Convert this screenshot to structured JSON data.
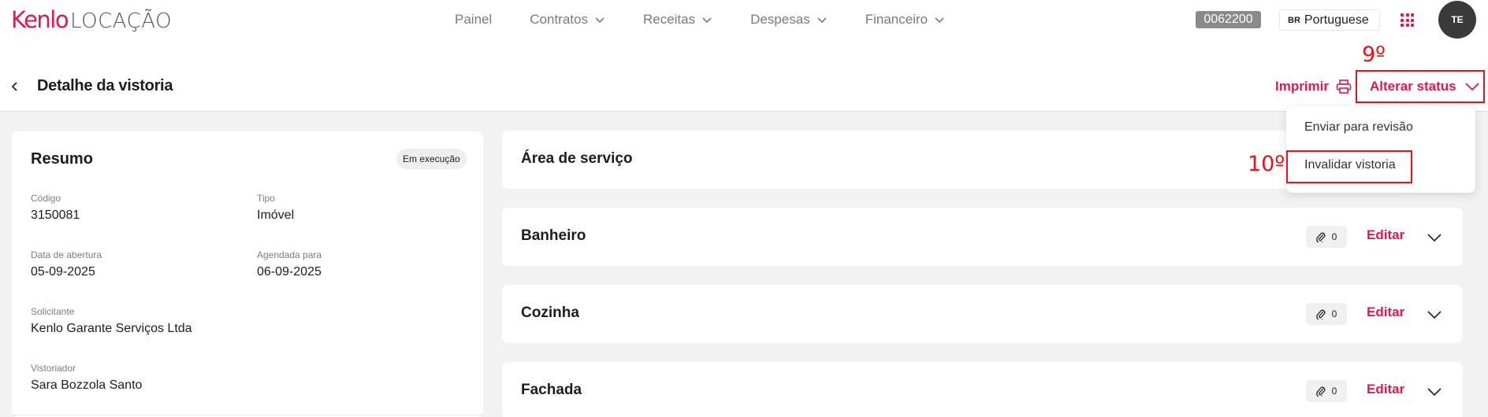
{
  "brand": {
    "name_a": "Kenlo",
    "name_b": "LOCAÇÃO",
    "accent": "#e0194f",
    "annotation_color": "#e4141b"
  },
  "nav": {
    "items": [
      {
        "label": "Painel",
        "has_dropdown": false
      },
      {
        "label": "Contratos",
        "has_dropdown": true
      },
      {
        "label": "Receitas",
        "has_dropdown": true
      },
      {
        "label": "Despesas",
        "has_dropdown": true
      },
      {
        "label": "Financeiro",
        "has_dropdown": true
      }
    ],
    "account_code": "0062200",
    "language": {
      "flag": "BR",
      "label": "Portuguese"
    },
    "apps_icon": "grid-icon",
    "avatar_initials": "TE"
  },
  "header": {
    "title": "Detalhe da vistoria",
    "print_label": "Imprimir",
    "status_label": "Alterar status"
  },
  "annotations": {
    "step_9": "9º",
    "step_10": "10º"
  },
  "status_menu": {
    "items": [
      "Enviar para revisão",
      "Invalidar vistoria"
    ]
  },
  "summary": {
    "title": "Resumo",
    "badge": "Em execução",
    "fields": [
      {
        "label": "Código",
        "value": "3150081"
      },
      {
        "label": "Tipo",
        "value": "Imóvel"
      },
      {
        "label": "Data de abertura",
        "value": "05-09-2025"
      },
      {
        "label": "Agendada para",
        "value": "06-09-2025"
      },
      {
        "label": "Solicitante",
        "value": "Kenlo Garante Serviços Ltda"
      },
      {
        "label": "Vistoriador",
        "value": "Sara Bozzola Santo"
      }
    ]
  },
  "sections": {
    "edit_label": "Editar",
    "items": [
      {
        "name": "Área de serviço",
        "attachments": ""
      },
      {
        "name": "Banheiro",
        "attachments": "0"
      },
      {
        "name": "Cozinha",
        "attachments": "0"
      },
      {
        "name": "Fachada",
        "attachments": "0"
      }
    ]
  }
}
